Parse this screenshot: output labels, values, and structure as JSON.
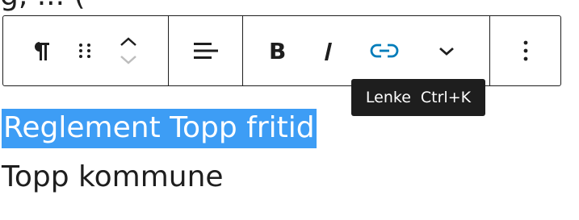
{
  "top_text": "g, ... (",
  "toolbar": {
    "paragraph_icon": "paragraph-icon",
    "drag_icon": "drag-handle-icon",
    "move_icon": "move-up-down-icon",
    "align_icon": "align-left-icon",
    "bold_icon": "bold-icon",
    "italic_icon": "italic-icon",
    "link_icon": "link-icon",
    "more_rich_icon": "chevron-down-icon",
    "options_icon": "more-vertical-icon",
    "accent_color": "#3858e9"
  },
  "tooltip": {
    "label": "Lenke",
    "shortcut": "Ctrl+K"
  },
  "content": {
    "heading": "Reglement Topp fritid",
    "subtitle": "Topp kommune"
  },
  "colors": {
    "selection": "#3d9df5",
    "link_blue": "#007cba"
  }
}
